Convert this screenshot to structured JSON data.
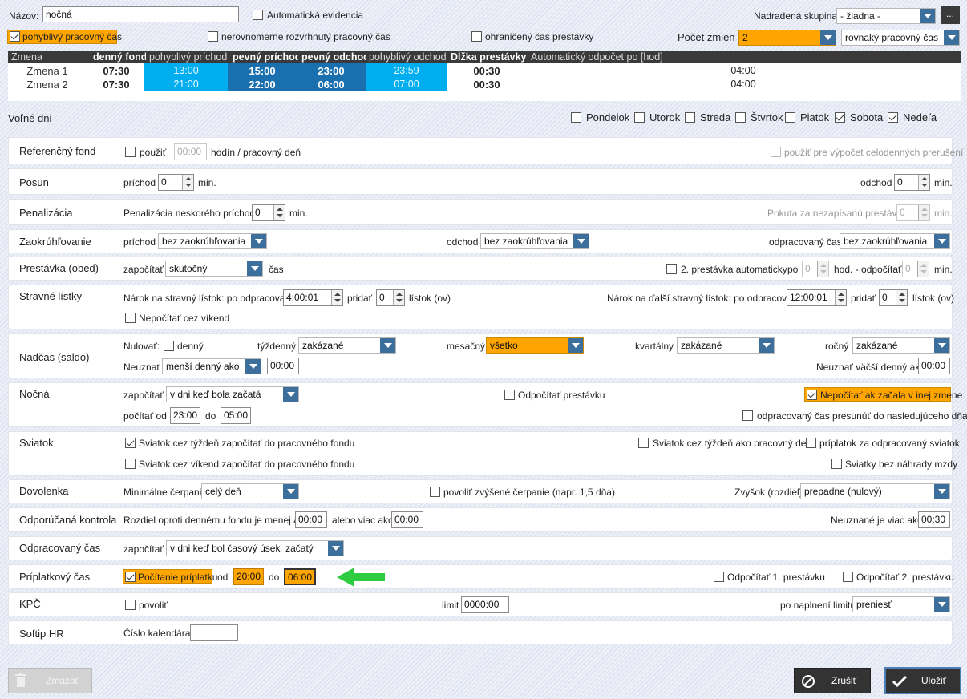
{
  "header": {
    "name_label": "Názov:",
    "name_value": "nočná",
    "auto_evidence": "Automatická evidencia",
    "parent_group_label": "Nadradená skupina:",
    "parent_group_value": "- žiadna -",
    "more": "..."
  },
  "flags": {
    "flexible": "pohyblivý pracovný čas",
    "uneven": "nerovnomerne rozvrhnutý pracovný čas",
    "limited_break": "ohraničený čas prestávky",
    "shift_count_label": "Počet zmien",
    "shift_count_value": "2",
    "distribution": "rovnaký pracovný čas"
  },
  "shift_table": {
    "headers": [
      "Zmena",
      "denný fond",
      "pohyblivý príchod",
      "pevný príchod",
      "pevný odchod",
      "pohyblivý odchod",
      "Dĺžka prestávky",
      "Automatický odpočet po [hod]"
    ],
    "rows": [
      {
        "name": "Zmena 1",
        "fund": "07:30",
        "flex_in": "13:00",
        "fixed_in": "15:00",
        "fixed_out": "23:00",
        "flex_out": "23:59",
        "break": "00:30",
        "auto": "04:00"
      },
      {
        "name": "Zmena 2",
        "fund": "07:30",
        "flex_in": "21:00",
        "fixed_in": "22:00",
        "fixed_out": "06:00",
        "flex_out": "07:00",
        "break": "00:30",
        "auto": "04:00"
      }
    ]
  },
  "free_days": {
    "label": "Voľné dni",
    "days": [
      {
        "name": "Pondelok",
        "checked": false
      },
      {
        "name": "Utorok",
        "checked": false
      },
      {
        "name": "Streda",
        "checked": false
      },
      {
        "name": "Štvrtok",
        "checked": false
      },
      {
        "name": "Piatok",
        "checked": false
      },
      {
        "name": "Sobota",
        "checked": true
      },
      {
        "name": "Nedeľa",
        "checked": true
      }
    ]
  },
  "ref_fund": {
    "title": "Referenčný fond",
    "use": "použiť",
    "hours": "00:00",
    "unit": "hodín / pracovný deň",
    "use_full": "použiť pre výpočet celodenných prerušení"
  },
  "shift_offset": {
    "title": "Posun",
    "arrival": "príchod",
    "arrival_val": "0",
    "min1": "min.",
    "departure": "odchod",
    "departure_val": "0",
    "min2": "min."
  },
  "penalty": {
    "title": "Penalizácia",
    "late": "Penalizácia neskorého príchodu:",
    "late_val": "0",
    "min1": "min.",
    "fine": "Pokuta za nezapísanú prestávku",
    "fine_val": "0",
    "min2": "min."
  },
  "rounding": {
    "title": "Zaokrúhľovanie",
    "arrival": "príchod",
    "arrival_val": "bez zaokrúhľovania",
    "departure": "odchod",
    "departure_val": "bez zaokrúhľovania",
    "worked": "odpracovaný čas",
    "worked_val": "bez zaokrúhľovania"
  },
  "break": {
    "title": "Prestávka (obed)",
    "count": "započítať",
    "count_val": "skutočný",
    "time": "čas",
    "second": "2. prestávka automaticky",
    "after": "po",
    "after_val": "0",
    "hours": "hod. - odpočítať",
    "deduct_val": "0",
    "min": "min."
  },
  "meal": {
    "title": "Stravné lístky",
    "entitle": "Nárok na stravný lístok: po odpracovaní",
    "entitle_val": "4:00:01",
    "add1": "pridať",
    "add1_val": "0",
    "tickets1": "lístok (ov)",
    "next": "Nárok na ďalší stravný lístok: po odpracovaní",
    "next_val": "12:00:01",
    "add2": "pridať",
    "add2_val": "0",
    "tickets2": "lístok (ov)",
    "weekend": "Nepočítať cez víkend"
  },
  "overtime": {
    "title": "Nadčas (saldo)",
    "reset": "Nulovať:",
    "daily": "denný",
    "weekly": "týždenný",
    "weekly_val": "zakázané",
    "monthly": "mesačný",
    "monthly_val": "všetko",
    "quarterly": "kvartálny",
    "quarterly_val": "zakázané",
    "yearly": "ročný",
    "yearly_val": "zakázané",
    "ignore": "Neuznať",
    "ignore_val": "menší denný ako",
    "ignore_time": "00:00",
    "ignore_more": "Neuznať väčší denný ako",
    "ignore_more_time": "00:00"
  },
  "night": {
    "title": "Nočná",
    "count": "započítať",
    "count_val": "v dni keď bola začatá",
    "deduct": "Odpočítať prestávku",
    "not_other": "Nepočítať ak začala v inej zmene",
    "from": "počítať od",
    "from_val": "23:00",
    "to": "do",
    "to_val": "05:00",
    "move": "odpracovaný čas presunúť do nasledujúceho dňa"
  },
  "holiday": {
    "title": "Sviatok",
    "week_fund": "Sviatok cez týždeň započítať do pracovného fondu",
    "weekend_fund": "Sviatok cez víkend započítať do pracovného fondu",
    "as_workday": "Sviatok cez týždeň ako pracovný deň",
    "bonus": "príplatok za odpracovaný sviatok",
    "no_comp": "Sviatky bez náhrady mzdy"
  },
  "vacation": {
    "title": "Dovolenka",
    "min": "Minimálne čerpanie",
    "min_val": "celý deň",
    "raised": "povoliť zvýšené čerpanie (napr. 1,5 dňa)",
    "rest": "Zvyšok (rozdiel)",
    "rest_val": "prepadne (nulový)"
  },
  "check": {
    "title": "Odporúčaná kontrola",
    "diff": "Rozdiel oproti dennému fondu je menej ako",
    "less_val": "00:00",
    "or_more": "alebo viac ako",
    "more_val": "00:00",
    "unrec": "Neuznané je viac ako",
    "unrec_val": "00:30"
  },
  "worked": {
    "title": "Odpracovaný čas",
    "count": "započítať",
    "count_val": "v dni keď bol časový úsek  začatý"
  },
  "surcharge": {
    "title": "Príplatkový čas",
    "calc": "Počítanie príplatku",
    "from": "od",
    "from_val": "20:00",
    "to": "do",
    "to_val": "06:00",
    "b1": "Odpočítať 1. prestávku",
    "b2": "Odpočítať 2. prestávku"
  },
  "kpc": {
    "title": "KPČ",
    "allow": "povoliť",
    "limit": "limit",
    "limit_val": "0000:00",
    "after": "po naplnení limitu",
    "after_val": "preniesť"
  },
  "softip": {
    "title": "Softip HR",
    "cal": "Číslo kalendára:",
    "cal_val": ""
  },
  "footer": {
    "delete": "Zmazať",
    "cancel": "Zrušiť",
    "save": "Uložiť"
  },
  "colors": {
    "accent_orange": "#ffa500",
    "flex_blue": "#00aeef",
    "fixed_blue": "#1a6fae",
    "dropdown_blue": "#3c6f9b",
    "arrow_green": "#2ecc40"
  }
}
